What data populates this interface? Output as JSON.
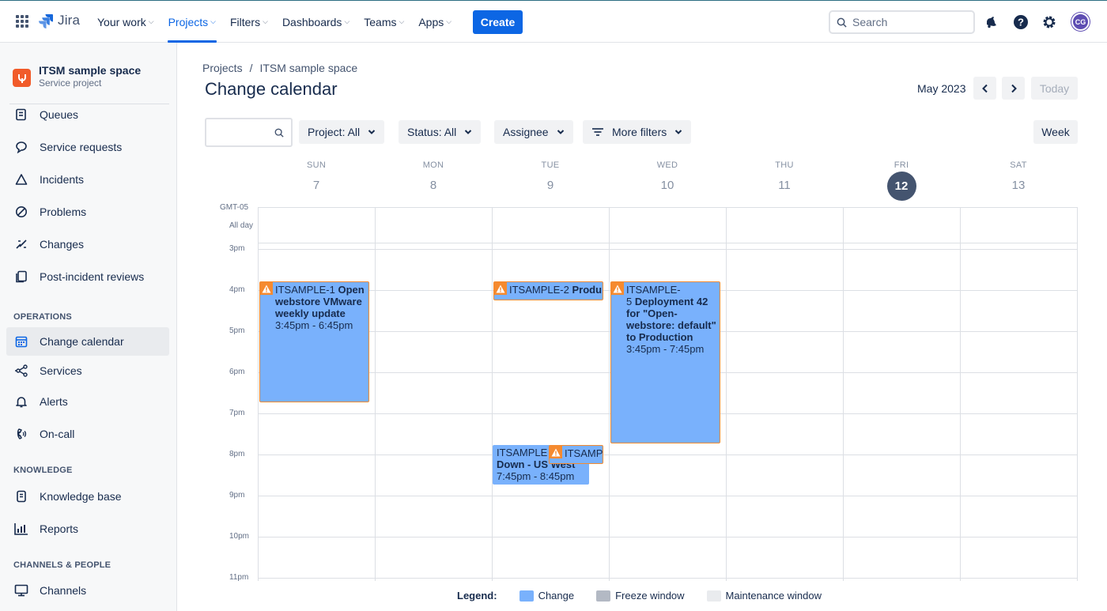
{
  "app": {
    "name": "Jira"
  },
  "topnav": {
    "items": [
      {
        "label": "Your work"
      },
      {
        "label": "Projects"
      },
      {
        "label": "Filters"
      },
      {
        "label": "Dashboards"
      },
      {
        "label": "Teams"
      },
      {
        "label": "Apps"
      }
    ],
    "create_label": "Create",
    "search_placeholder": "Search",
    "avatar_initials": "CG"
  },
  "sidebar": {
    "project_name": "ITSM sample space",
    "project_type": "Service project",
    "items_top": [
      {
        "label": "Queues",
        "icon": "queues-icon"
      },
      {
        "label": "Service requests",
        "icon": "chat-icon"
      },
      {
        "label": "Incidents",
        "icon": "warning-triangle-icon"
      },
      {
        "label": "Problems",
        "icon": "problem-icon"
      },
      {
        "label": "Changes",
        "icon": "changes-icon"
      },
      {
        "label": "Post-incident reviews",
        "icon": "document-icon"
      }
    ],
    "section_operations": "OPERATIONS",
    "items_operations": [
      {
        "label": "Change calendar",
        "icon": "calendar-icon"
      },
      {
        "label": "Services",
        "icon": "services-icon"
      },
      {
        "label": "Alerts",
        "icon": "bell-icon"
      },
      {
        "label": "On-call",
        "icon": "phone-icon"
      }
    ],
    "section_knowledge": "KNOWLEDGE",
    "items_knowledge": [
      {
        "label": "Knowledge base",
        "icon": "book-icon"
      },
      {
        "label": "Reports",
        "icon": "chart-icon"
      }
    ],
    "section_channels": "CHANNELS & PEOPLE",
    "items_channels": [
      {
        "label": "Channels",
        "icon": "monitor-icon"
      }
    ]
  },
  "breadcrumb": {
    "root": "Projects",
    "separator": "/",
    "current": "ITSM sample space"
  },
  "page": {
    "title": "Change calendar",
    "month": "May 2023",
    "today_label": "Today",
    "view_label": "Week"
  },
  "filters": {
    "project": "Project: All",
    "status": "Status: All",
    "assignee": "Assignee",
    "more": "More filters"
  },
  "calendar": {
    "timezone": "GMT-05",
    "allday_label": "All day",
    "days": [
      {
        "name": "SUN",
        "num": "7"
      },
      {
        "name": "MON",
        "num": "8"
      },
      {
        "name": "TUE",
        "num": "9"
      },
      {
        "name": "WED",
        "num": "10"
      },
      {
        "name": "THU",
        "num": "11"
      },
      {
        "name": "FRI",
        "num": "12"
      },
      {
        "name": "SAT",
        "num": "13"
      }
    ],
    "hours": [
      "3pm",
      "4pm",
      "5pm",
      "6pm",
      "7pm",
      "8pm",
      "9pm",
      "10pm",
      "11pm"
    ],
    "events": {
      "e1_key": "ITSAMPLE-1",
      "e1_title": "Open webstore VMware weekly update",
      "e1_time": "3:45pm - 6:45pm",
      "e2_key": "ITSAMPLE-2",
      "e2_title": "Produ",
      "e3_key": "ITSAMPLE-",
      "e3_key2": "5",
      "e3_title": "Deployment 42 for \"Open-webstore: default\" to Production",
      "e3_time": "3:45pm - 7:45pm",
      "e4_key": "ITSAMPLE",
      "e4_title": "Down - US West",
      "e4_time": "7:45pm - 8:45pm",
      "e5_key": "ITSAMP"
    }
  },
  "legend": {
    "title": "Legend:",
    "items": [
      {
        "label": "Change",
        "color": "#79b1fc"
      },
      {
        "label": "Freeze window",
        "color": "#b3b9c4"
      },
      {
        "label": "Maintenance window",
        "color": "#e9ebee"
      }
    ]
  }
}
